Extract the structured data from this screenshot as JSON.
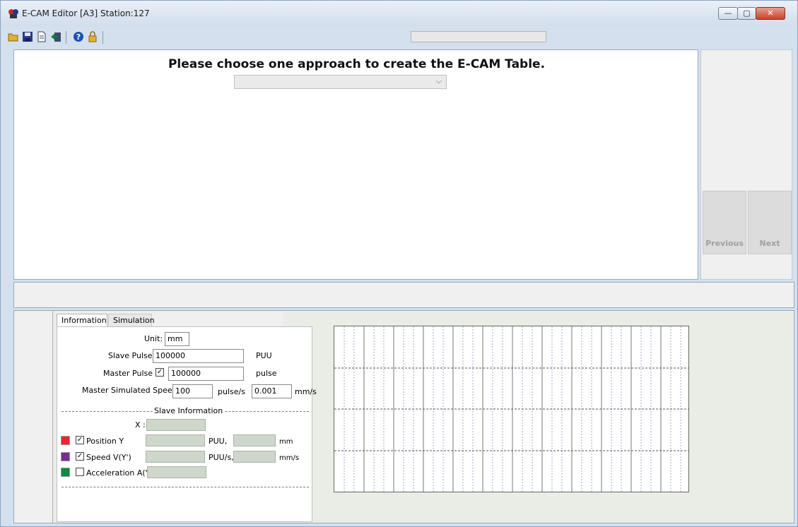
{
  "window": {
    "title": "E-CAM Editor [A3] Station:127",
    "buttons": {
      "minimize": "—",
      "maximize": "▢",
      "close": "✕"
    }
  },
  "toolbar": {
    "icons": [
      "open-folder-icon",
      "save-icon",
      "new-document-icon",
      "export-icon",
      "help-icon",
      "lock-icon"
    ]
  },
  "main": {
    "heading": "Please choose one approach to create the E-CAM Table.",
    "approach_select": {
      "value": "",
      "chevron": "⌵"
    }
  },
  "nav": {
    "previous": "Previous",
    "next": "Next"
  },
  "tabs": {
    "information": "Information",
    "simulation": "Simulation"
  },
  "info": {
    "unit_label": "Unit:",
    "unit_value": "mm",
    "slave_pulse_label": "Slave Pulse",
    "slave_pulse_value": "100000",
    "slave_pulse_unit": "PUU",
    "master_pulse_label": "Master Pulse",
    "master_pulse_value": "100000",
    "master_pulse_unit": "pulse",
    "master_speed_label": "Master Simulated Speed",
    "master_speed_value": "100",
    "master_speed_unit": "pulse/s",
    "master_speed_mm_value": "0.001",
    "master_speed_mm_unit": "mm/s",
    "slave_info_label": "Slave Information",
    "x_label": "X :",
    "position_label": "Position Y",
    "position_unit1": "PUU,",
    "position_unit2": "mm",
    "speed_label": "Speed V(Y')",
    "speed_unit1": "PUU/s,",
    "speed_unit2": "mm/s",
    "accel_label": "Acceleration A(Y",
    "checkmark": "✓",
    "colors": {
      "position": "#e8262b",
      "speed": "#7b2a8e",
      "acceleration": "#0f8a3e"
    }
  }
}
